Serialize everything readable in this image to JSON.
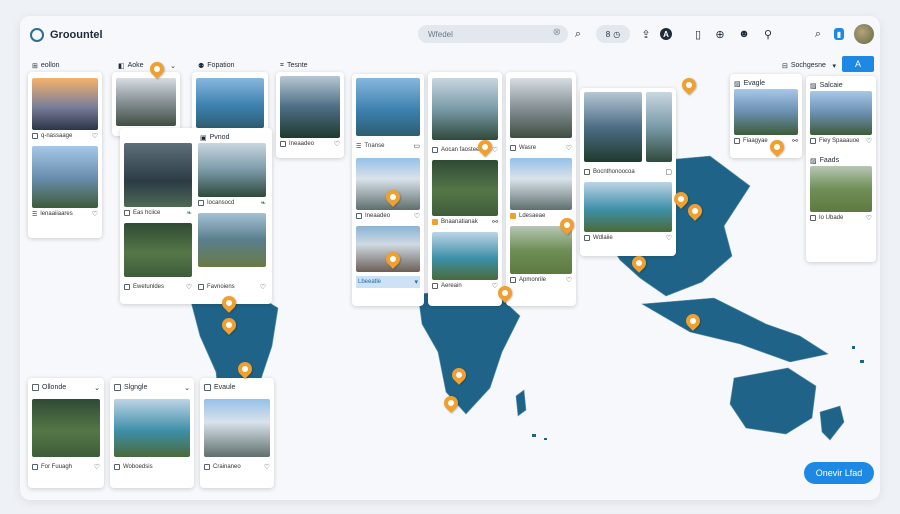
{
  "app": {
    "title": "Groountel"
  },
  "search": {
    "value": "Wfedel",
    "clear": "⊗"
  },
  "toolbar": {
    "pill_label": "8",
    "avatar_alt": ""
  },
  "filters": [
    {
      "label": "eollon"
    },
    {
      "label": "Aoke"
    },
    {
      "label": "Fopation"
    },
    {
      "label": "Tesnte"
    }
  ],
  "right_controls": {
    "sort_label": "Sochgesne",
    "action_label": "A"
  },
  "cards": {
    "c1": {
      "caption_top": "q-nassaage",
      "caption_bottom": "lenaaiiaares"
    },
    "c2": {
      "header": "Pvnod",
      "caption_left": "Eas hciice",
      "caption_right": "Iocansocd"
    },
    "c3": {
      "caption": "Ewetunldes"
    },
    "c4": {
      "caption": "Favnoiens"
    },
    "c5": {
      "caption": "Tnanse",
      "caption_b": "Ineaadeo",
      "selected": "Lbeeatle"
    },
    "c6": {
      "caption": "Aocan faostee",
      "caption_b": "Bnaanatianak",
      "caption_c": "Aereain"
    },
    "c7": {
      "caption": "Wasre",
      "caption_b": "Ldesaeae",
      "caption_c": "Apmonrile"
    },
    "c8": {
      "caption": "Bocnthonoocoa",
      "caption_b": "Wdlaiie"
    },
    "c9": {
      "header": "Evagle",
      "caption": "Fiaagyae"
    },
    "c10": {
      "header": "Salcaie",
      "caption": "Fiey Spaaauoe",
      "header_b": "Faads",
      "caption_b": "Io Ubade"
    },
    "c11": {
      "header": "Ollonde",
      "caption": "For Fuuagh"
    },
    "c12": {
      "header": "Slgngle",
      "caption": "Woboedsis"
    },
    "c13": {
      "header": "Evaule",
      "caption": "Crainaneo"
    }
  },
  "footer_button": {
    "label": "Onevir Lfad"
  },
  "colors": {
    "map": "#1f6488",
    "accent": "#1e88e5",
    "pin": "#f0a030"
  }
}
